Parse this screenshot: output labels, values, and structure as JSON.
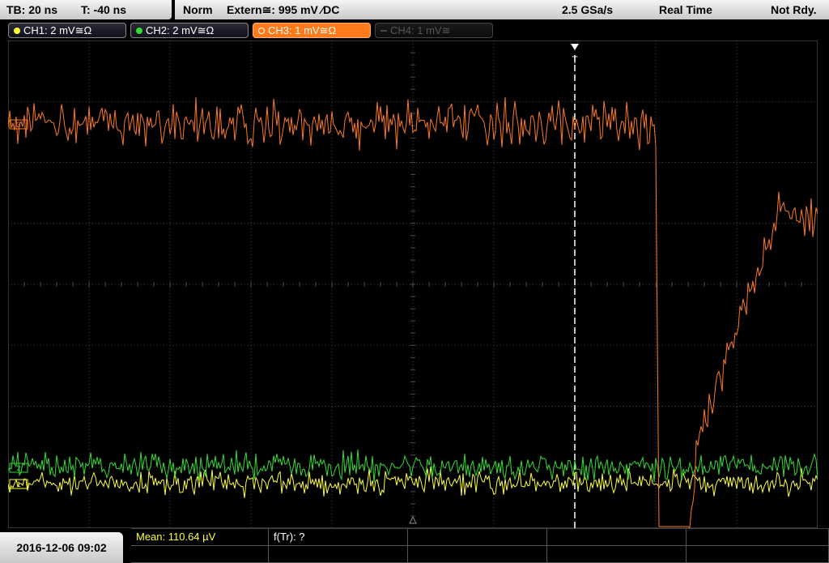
{
  "timebase": {
    "tb": "TB: 20 ns",
    "t": "T: -40 ns"
  },
  "status": {
    "mode": "Norm",
    "trigger": "Extern≅: 995 mV ⁄DC",
    "sample_rate": "2.5 GSa/s",
    "acq": "Real Time",
    "ready": "Not Rdy."
  },
  "channels": [
    {
      "label": "CH1: 2 mV≅Ω",
      "color": "#ffff33",
      "state": "on"
    },
    {
      "label": "CH2: 2 mV≅Ω",
      "color": "#33dd33",
      "state": "on"
    },
    {
      "label": "CH3: 1 mV≅Ω",
      "color": "#ff7a1a",
      "state": "selected"
    },
    {
      "label": "CH4: 1 mV≅",
      "color": "#555555",
      "state": "off"
    }
  ],
  "trigger_marker": "T",
  "datetime": "2016-12-06 09:02",
  "measurements": {
    "mean": "Mean: 110.64 µV",
    "f_tr": "f(Tr): ?"
  },
  "colors": {
    "ch1": "#ffff33",
    "ch2": "#33dd33",
    "ch3": "#ff7a1a",
    "grid": "#555555",
    "trigger_line": "#ffffff"
  }
}
